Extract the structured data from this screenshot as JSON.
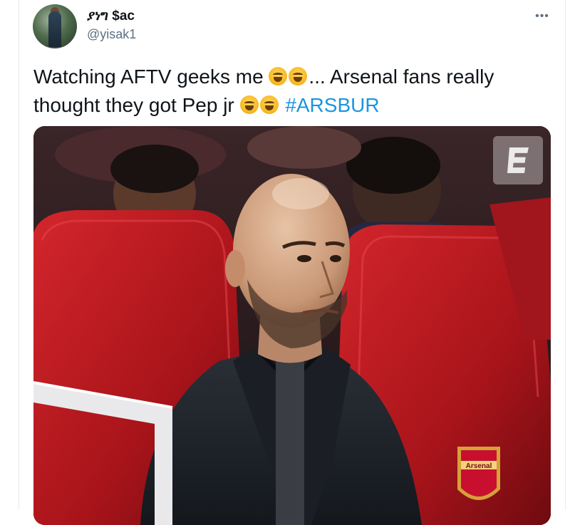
{
  "tweet": {
    "author": {
      "display_name": "ያነግ $ac",
      "handle": "@yisak1",
      "avatar": "user-avatar-photo"
    },
    "more_icon": "•••",
    "text_line1_a": "Watching AFTV geeks me ",
    "text_line1_b": "... Arsenal fans really",
    "text_line2_a": "thought they got Pep jr ",
    "hashtag": "#ARSBUR",
    "emoji": "face-with-tears-of-joy",
    "media": {
      "description_icon": "photo-of-coach-in-dugout",
      "watermark": "espn-e-logo",
      "crest_text": "Arsenal"
    }
  },
  "colors": {
    "text": "#0f1419",
    "secondary": "#5b7083",
    "link": "#1b95e0",
    "seat_red": "#b3151b"
  }
}
